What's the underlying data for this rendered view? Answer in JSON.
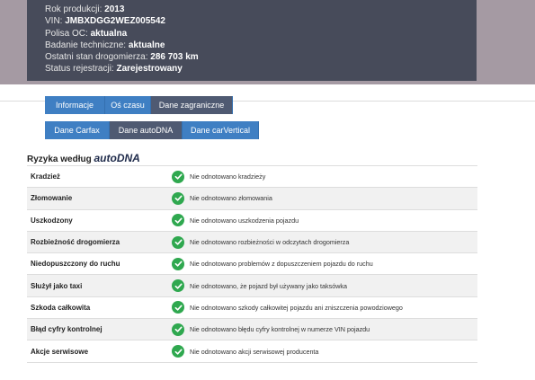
{
  "vehicle": {
    "year_label": "Rok produkcji:",
    "year": "2013",
    "vin_label": "VIN:",
    "vin": "JMBXDGG2WEZ005542",
    "oc_label": "Polisa OC:",
    "oc": "aktualna",
    "inspection_label": "Badanie techniczne:",
    "inspection": "aktualne",
    "odometer_label": "Ostatni stan drogomierza:",
    "odometer": "286 703 km",
    "registration_label": "Status rejestracji:",
    "registration": "Zarejestrowany"
  },
  "main_tabs": [
    {
      "label": "Informacje",
      "active": false
    },
    {
      "label": "Oś czasu",
      "active": false
    },
    {
      "label": "Dane zagraniczne",
      "active": true
    }
  ],
  "sub_tabs": [
    {
      "label": "Dane Carfax",
      "active": false
    },
    {
      "label": "Dane autoDNA",
      "active": true
    },
    {
      "label": "Dane carVertical",
      "active": false
    }
  ],
  "risk_section": {
    "title": "Ryzyka według",
    "brand": "autoDNA"
  },
  "risks": [
    {
      "name": "Kradzież",
      "status": "Nie odnotowano kradzieży"
    },
    {
      "name": "Złomowanie",
      "status": "Nie odnotowano złomowania"
    },
    {
      "name": "Uszkodzony",
      "status": "Nie odnotowano uszkodzenia pojazdu"
    },
    {
      "name": "Rozbieżność drogomierza",
      "status": "Nie odnotowano rozbieżności w odczytach drogomierza"
    },
    {
      "name": "Niedopuszczony do ruchu",
      "status": "Nie odnotowano problemów z dopuszczeniem pojazdu do ruchu"
    },
    {
      "name": "Służył jako taxi",
      "status": "Nie odnotowano, że pojazd był używany jako taksówka"
    },
    {
      "name": "Szkoda całkowita",
      "status": "Nie odnotowano szkody całkowitej pojazdu ani zniszczenia powodziowego"
    },
    {
      "name": "Błąd cyfry kontrolnej",
      "status": "Nie odnotowano błędu cyfry kontrolnej w numerze VIN pojazdu"
    },
    {
      "name": "Akcje serwisowe",
      "status": "Nie odnotowano akcji serwisowej producenta"
    }
  ],
  "icons": {
    "status": "check-circle-icon"
  },
  "colors": {
    "tab": "#3f7fc3",
    "tab_active": "#4f5a72",
    "check": "#2fa84f",
    "card": "#474b5a"
  }
}
